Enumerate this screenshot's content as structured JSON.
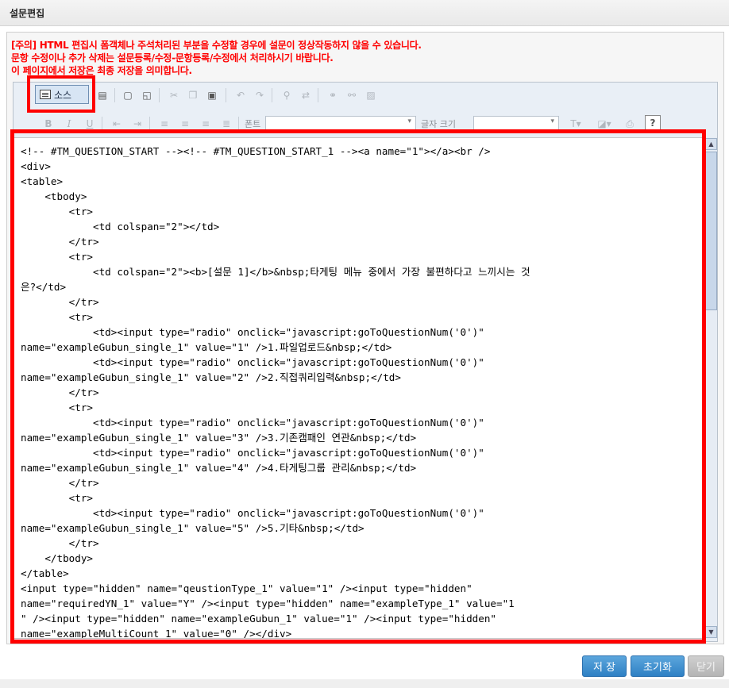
{
  "header": {
    "title": "설문편집"
  },
  "warnings": [
    "[주의] HTML 편집시 폼객체나 주석처리된 부분을 수정할 경우에 설문이 정상작동하지 않을 수 있습니다.",
    "문항 수정이나 추가 삭제는 설문등록/수정-문항등록/수정에서 처리하시기 바랍니다.",
    "이 페이지에서 저장은 최종 저장을 의미합니다."
  ],
  "toolbar": {
    "source_label": "소스",
    "font_label": "폰트",
    "font_size_label": "글자 크기",
    "bold": "B",
    "italic": "I",
    "underline": "U",
    "help": "?"
  },
  "code_lines": [
    "<!-- #TM_QUESTION_START --><!-- #TM_QUESTION_START_1 --><a name=\"1\"></a><br />",
    "<div>",
    "<table>",
    "    <tbody>",
    "        <tr>",
    "            <td colspan=\"2\"></td>",
    "        </tr>",
    "        <tr>",
    "            <td colspan=\"2\"><b>[설문 1]</b>&nbsp;타게팅 메뉴 중에서 가장 불편하다고 느끼시는 것",
    "은?</td>",
    "        </tr>",
    "        <tr>",
    "            <td><input type=\"radio\" onclick=\"javascript:goToQuestionNum('0')\"",
    "name=\"exampleGubun_single_1\" value=\"1\" />1.파일업로드&nbsp;</td>",
    "            <td><input type=\"radio\" onclick=\"javascript:goToQuestionNum('0')\"",
    "name=\"exampleGubun_single_1\" value=\"2\" />2.직접쿼리입력&nbsp;</td>",
    "        </tr>",
    "        <tr>",
    "            <td><input type=\"radio\" onclick=\"javascript:goToQuestionNum('0')\"",
    "name=\"exampleGubun_single_1\" value=\"3\" />3.기존캠패인 연관&nbsp;</td>",
    "            <td><input type=\"radio\" onclick=\"javascript:goToQuestionNum('0')\"",
    "name=\"exampleGubun_single_1\" value=\"4\" />4.타게팅그룹 관리&nbsp;</td>",
    "        </tr>",
    "        <tr>",
    "            <td><input type=\"radio\" onclick=\"javascript:goToQuestionNum('0')\"",
    "name=\"exampleGubun_single_1\" value=\"5\" />5.기타&nbsp;</td>",
    "        </tr>",
    "    </tbody>",
    "</table>",
    "<input type=\"hidden\" name=\"qeustionType_1\" value=\"1\" /><input type=\"hidden\"",
    "name=\"requiredYN_1\" value=\"Y\" /><input type=\"hidden\" name=\"exampleType_1\" value=\"1",
    "\" /><input type=\"hidden\" name=\"exampleGubun_1\" value=\"1\" /><input type=\"hidden\"",
    "name=\"exampleMultiCount_1\" value=\"0\" /></div>"
  ],
  "buttons": {
    "save": "저 장",
    "reset": "초기화",
    "close": "닫기"
  },
  "colors": {
    "warning": "#ff0000",
    "highlight": "#ff0000",
    "primary_button": "#3a8bcf",
    "disabled_button": "#c4c4c4"
  }
}
